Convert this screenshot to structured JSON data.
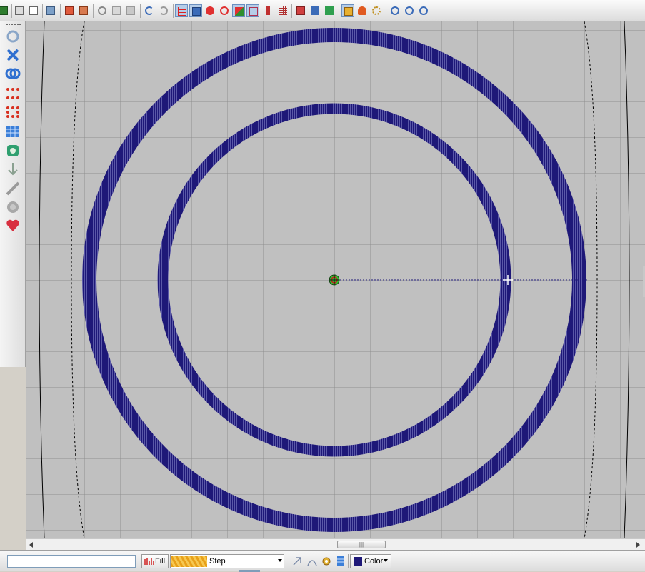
{
  "colors": {
    "canvas_bg": "#c0c0c0",
    "grid_line": "#8f8f8f",
    "stitch": "#1e1878",
    "hoop_line": "#000000"
  },
  "toolbar_top": {
    "icons": [
      "save-icon",
      "print-icon",
      "print-preview-icon",
      "send-to-machine-icon",
      "import-icon",
      "export-icon",
      "cut-icon",
      "copy-icon",
      "paste-icon",
      "undo-icon",
      "redo-icon",
      "show-grid-icon",
      "show-hoop-icon",
      "show-stitches-icon",
      "show-points-icon",
      "color-view-icon",
      "wireframe-icon",
      "tool-icon",
      "grid-view-icon",
      "group-icon",
      "align-icon",
      "stack-icon",
      "fit-icon",
      "person-icon",
      "swirl-icon",
      "zoom-out-icon",
      "zoom-in-icon",
      "zoom-fit-icon"
    ]
  },
  "toolbar_left": {
    "icons": [
      "rotate-icon",
      "delete-icon",
      "mirror-icon",
      "run-stitch-icon",
      "triple-run-icon",
      "grid-fill-icon",
      "applique-icon",
      "arrow-down-icon",
      "feather-icon",
      "sphere-icon",
      "heart-icon"
    ]
  },
  "bottom": {
    "name_value": "",
    "fill_label": "Fill",
    "step_label": "Step",
    "color_label": "Color"
  },
  "scroll": {
    "thumb_label": "|||"
  }
}
